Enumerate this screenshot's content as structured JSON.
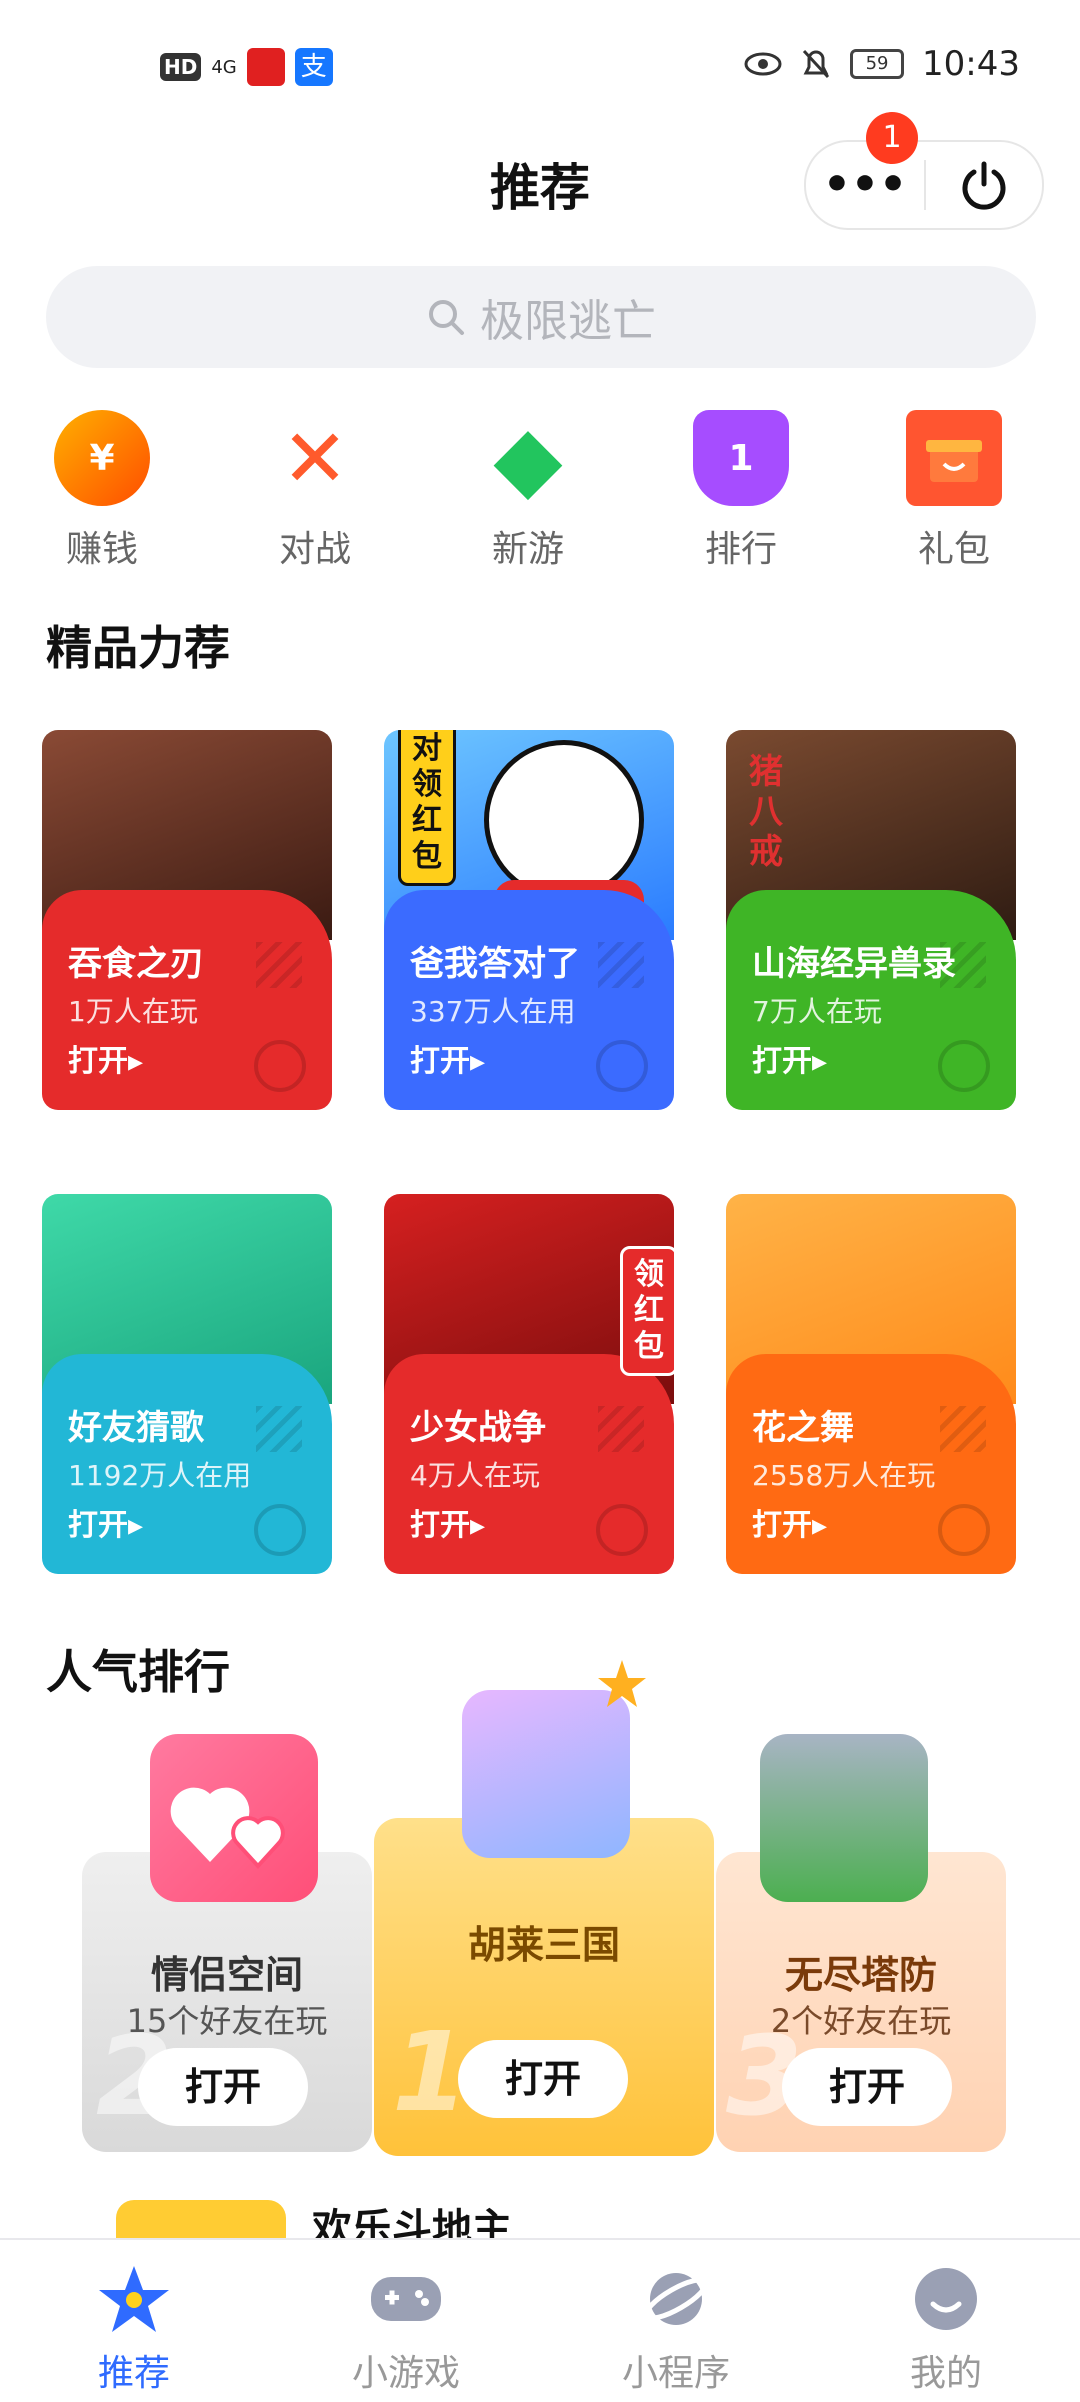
{
  "status_bar": {
    "left": {
      "hd": "HD",
      "network": "4G",
      "alipay_glyph": "支"
    },
    "battery": "59",
    "time": "10:43"
  },
  "header": {
    "title": "推荐",
    "more_badge": "1"
  },
  "search": {
    "placeholder": "极限逃亡"
  },
  "quick_actions": [
    {
      "label": "赚钱",
      "icon": "coin-icon",
      "glyph": "¥",
      "color": "#ff8a00"
    },
    {
      "label": "对战",
      "icon": "battle-icon",
      "glyph": "✕",
      "color": "#ff5a2c"
    },
    {
      "label": "新游",
      "icon": "diamond-icon",
      "glyph": "◆",
      "color": "#22c55e"
    },
    {
      "label": "排行",
      "icon": "trophy-icon",
      "glyph": "1",
      "color": "#a64dff"
    },
    {
      "label": "礼包",
      "icon": "gift-icon",
      "glyph": "🎁",
      "color": "#ff5530"
    }
  ],
  "featured": {
    "title": "精品力荐",
    "open_label": "打开▸",
    "cards": [
      {
        "name": "吞食之刃",
        "players": "1万人在玩",
        "color": "#e52b2b",
        "art": "#7a3b2a"
      },
      {
        "name": "爸我答对了",
        "players": "337万人在用",
        "color": "#3b6bff",
        "art": "#4aa3ff",
        "tag": "答对领红包"
      },
      {
        "name": "山海经异兽录",
        "players": "7万人在玩",
        "color": "#3fb526",
        "art": "#5a3a2a",
        "tag": "猪八戒"
      },
      {
        "name": "好友猜歌",
        "players": "1192万人在用",
        "color": "#22b7d6",
        "art": "#2fc9a0"
      },
      {
        "name": "少女战争",
        "players": "4万人在玩",
        "color": "#e52b2b",
        "art": "#b01c1c",
        "tag": "领红包"
      },
      {
        "name": "花之舞",
        "players": "2558万人在玩",
        "color": "#ff6a13",
        "art": "#ff9a2a"
      }
    ]
  },
  "ranking": {
    "title": "人气排行",
    "open_label": "打开",
    "items": [
      {
        "rank": "1",
        "name": "胡莱三国",
        "friends": ""
      },
      {
        "rank": "2",
        "name": "情侣空间",
        "friends": "15个好友在玩"
      },
      {
        "rank": "3",
        "name": "无尽塔防",
        "friends": "2个好友在玩"
      }
    ],
    "next_item": "欢乐斗地主"
  },
  "tabbar": [
    {
      "label": "推荐",
      "icon": "star-icon",
      "active": true
    },
    {
      "label": "小游戏",
      "icon": "gamepad-icon",
      "active": false
    },
    {
      "label": "小程序",
      "icon": "planet-icon",
      "active": false
    },
    {
      "label": "我的",
      "icon": "profile-icon",
      "active": false
    }
  ]
}
